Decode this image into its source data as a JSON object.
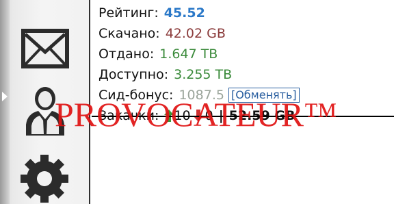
{
  "sidebar": {
    "icons": [
      "mail-icon",
      "user-icon",
      "gear-icon"
    ]
  },
  "stats": {
    "rating_label": "Рейтинг:",
    "rating_value": "45.52",
    "downloaded_label": "Скачано:",
    "downloaded_value": "42.02 GB",
    "uploaded_label": "Отдано:",
    "uploaded_value": "1.647 TB",
    "available_label": "Доступно:",
    "available_value": "3.255 TB",
    "seed_bonus_label": "Сид-бонус:",
    "seed_bonus_value": "1087.5",
    "exchange_link": "[Обменять]",
    "downloads_label": "Закачки:",
    "downloads_up": "10",
    "downloads_down": "0",
    "separator": "|",
    "downloads_total": "52.59 GB"
  },
  "watermark": "PROVOCATEUR™",
  "colors": {
    "rating": "#2a78c8",
    "downloaded": "#8b3c3c",
    "uploaded": "#3a8a3a",
    "up_arrow": "#3a9a3a",
    "down_arrow": "#d03030",
    "watermark": "#e01212"
  }
}
